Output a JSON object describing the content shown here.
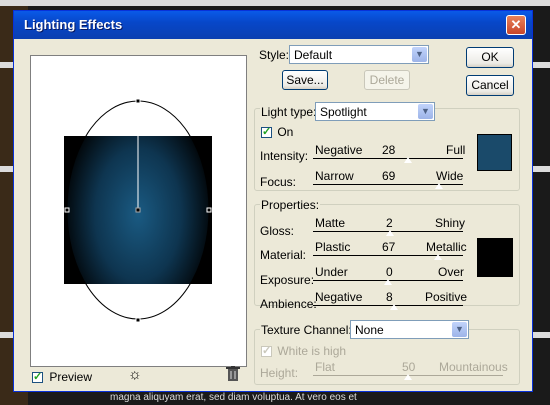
{
  "window": {
    "title": "Lighting Effects"
  },
  "buttons": {
    "ok": "OK",
    "cancel": "Cancel",
    "save": "Save...",
    "delete": "Delete"
  },
  "style": {
    "label": "Style:",
    "value": "Default"
  },
  "light": {
    "type_label": "Light type:",
    "type_value": "Spotlight",
    "on_label": "On",
    "on_checked": true,
    "intensity": {
      "label": "Intensity:",
      "min": "Negative",
      "value": "28",
      "max": "Full",
      "position": 0.63
    },
    "focus": {
      "label": "Focus:",
      "min": "Narrow",
      "value": "69",
      "max": "Wide",
      "position": 0.84
    },
    "color": "#1a4a6a"
  },
  "properties": {
    "title": "Properties:",
    "gloss": {
      "label": "Gloss:",
      "min": "Matte",
      "value": "2",
      "max": "Shiny",
      "position": 0.51
    },
    "material": {
      "label": "Material:",
      "min": "Plastic",
      "value": "67",
      "max": "Metallic",
      "position": 0.83
    },
    "exposure": {
      "label": "Exposure:",
      "min": "Under",
      "value": "0",
      "max": "Over",
      "position": 0.5
    },
    "ambience": {
      "label": "Ambience:",
      "min": "Negative",
      "value": "8",
      "max": "Positive",
      "position": 0.54
    },
    "color": "#000000"
  },
  "texture": {
    "label": "Texture Channel:",
    "value": "None",
    "white_is_high": "White is high",
    "height": {
      "label": "Height:",
      "min": "Flat",
      "value": "50",
      "max": "Mountainous",
      "position": 0.5
    }
  },
  "footer": {
    "preview_label": "Preview",
    "preview_checked": true,
    "bulb_icon": "light-bulb-icon",
    "trash_icon": "trash-icon"
  },
  "background": {
    "caption": "magna aliquyam erat, sed diam voluptua. At vero eos et"
  }
}
